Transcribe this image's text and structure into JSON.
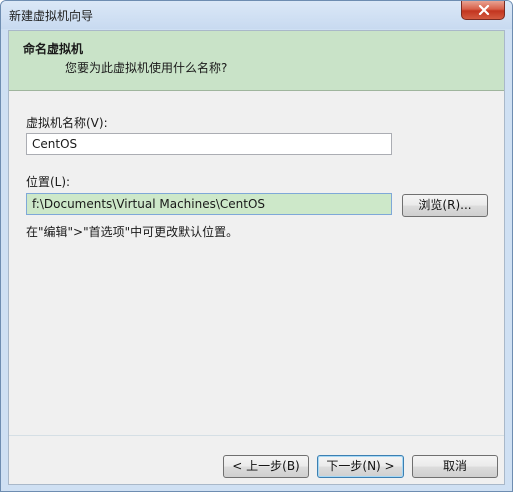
{
  "window": {
    "title": "新建虚拟机向导"
  },
  "header": {
    "title": "命名虚拟机",
    "subtitle": "您要为此虚拟机使用什么名称?"
  },
  "form": {
    "vm_name_label": "虚拟机名称(V):",
    "vm_name_value": "CentOS",
    "location_label": "位置(L):",
    "location_value": "f:\\Documents\\Virtual Machines\\CentOS",
    "browse_label": "浏览(R)...",
    "hint": "在\"编辑\">\"首选项\"中可更改默认位置。"
  },
  "footer": {
    "back_label": "< 上一步(B)",
    "next_label": "下一步(N) >",
    "cancel_label": "取消"
  },
  "icons": {
    "close": "close-icon"
  }
}
